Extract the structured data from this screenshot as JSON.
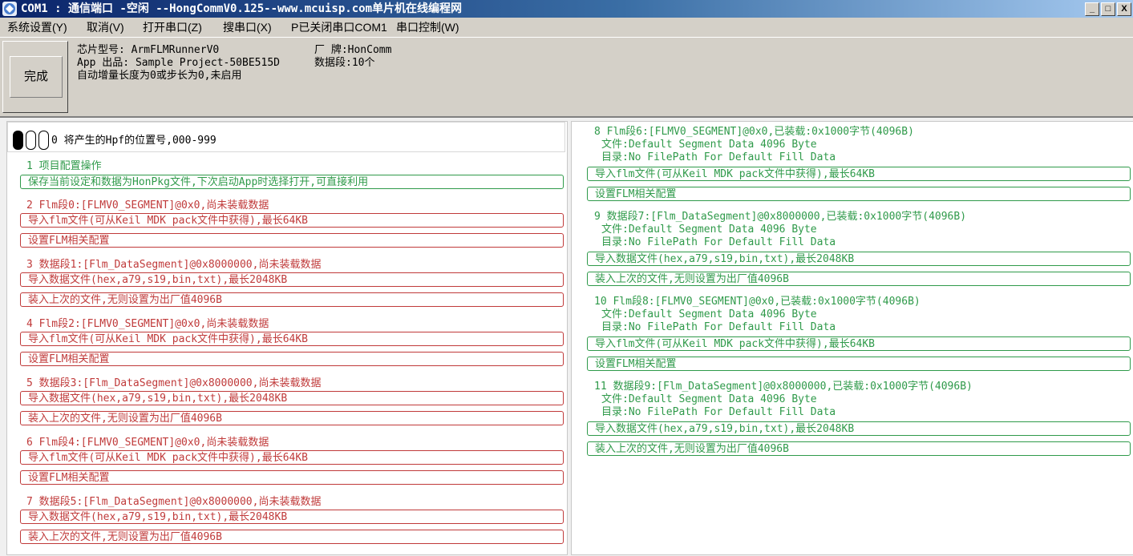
{
  "window": {
    "title": "COM1 : 通信端口 -空闲  --HongCommV0.125--www.mcuisp.com单片机在线编程网",
    "minimize": "_",
    "maximize": "□",
    "close": "X"
  },
  "menu": [
    "系统设置(Y)",
    "取消(V)",
    "打开串口(Z)",
    "搜串口(X)",
    "P已关闭串口COM1",
    "串口控制(W)"
  ],
  "done_button": "完成",
  "info": {
    "chip": "芯片型号: ArmFLMRunnerV0",
    "vendor": "厂  牌:HonComm",
    "app": "App 出品: Sample Project-50BE515D",
    "segments": "数据段:10个",
    "autoinc": "自动增量长度为0或步长为0,未启用"
  },
  "hpf": "0 将产生的Hpf的位置号,000-999",
  "left": {
    "project": {
      "title": "1 项目配置操作",
      "save": "保存当前设定和数据为HonPkg文件,下次启动App时选择打开,可直接利用"
    },
    "sec2": {
      "title": "2  Flm段0:[FLMV0_SEGMENT]@0x0,尚未装载数据",
      "b1": "导入flm文件(可从Keil MDK pack文件中获得),最长64KB",
      "b2": "设置FLM相关配置"
    },
    "sec3": {
      "title": "3 数据段1:[Flm_DataSegment]@0x8000000,尚未装载数据",
      "b1": "导入数据文件(hex,a79,s19,bin,txt),最长2048KB",
      "b2": "装入上次的文件,无则设置为出厂值4096B"
    },
    "sec4": {
      "title": "4  Flm段2:[FLMV0_SEGMENT]@0x0,尚未装载数据",
      "b1": "导入flm文件(可从Keil MDK pack文件中获得),最长64KB",
      "b2": "设置FLM相关配置"
    },
    "sec5": {
      "title": "5 数据段3:[Flm_DataSegment]@0x8000000,尚未装载数据",
      "b1": "导入数据文件(hex,a79,s19,bin,txt),最长2048KB",
      "b2": "装入上次的文件,无则设置为出厂值4096B"
    },
    "sec6": {
      "title": "6  Flm段4:[FLMV0_SEGMENT]@0x0,尚未装载数据",
      "b1": "导入flm文件(可从Keil MDK pack文件中获得),最长64KB",
      "b2": "设置FLM相关配置"
    },
    "sec7": {
      "title": "7 数据段5:[Flm_DataSegment]@0x8000000,尚未装载数据",
      "b1": "导入数据文件(hex,a79,s19,bin,txt),最长2048KB",
      "b2": "装入上次的文件,无则设置为出厂值4096B"
    }
  },
  "right": {
    "sec8": {
      "title": "8  Flm段6:[FLMV0_SEGMENT]@0x0,已装载:0x1000字节(4096B)",
      "file": "文件:Default Segment Data 4096 Byte",
      "dir": "目录:No FilePath For Default Fill Data",
      "b1": "导入flm文件(可从Keil MDK pack文件中获得),最长64KB",
      "b2": "设置FLM相关配置"
    },
    "sec9": {
      "title": "9 数据段7:[Flm_DataSegment]@0x8000000,已装载:0x1000字节(4096B)",
      "file": "文件:Default Segment Data 4096 Byte",
      "dir": "目录:No FilePath For Default Fill Data",
      "b1": "导入数据文件(hex,a79,s19,bin,txt),最长2048KB",
      "b2": "装入上次的文件,无则设置为出厂值4096B"
    },
    "sec10": {
      "title": "10  Flm段8:[FLMV0_SEGMENT]@0x0,已装载:0x1000字节(4096B)",
      "file": "文件:Default Segment Data 4096 Byte",
      "dir": "目录:No FilePath For Default Fill Data",
      "b1": "导入flm文件(可从Keil MDK pack文件中获得),最长64KB",
      "b2": "设置FLM相关配置"
    },
    "sec11": {
      "title": "11 数据段9:[Flm_DataSegment]@0x8000000,已装载:0x1000字节(4096B)",
      "file": "文件:Default Segment Data 4096 Byte",
      "dir": "目录:No FilePath For Default Fill Data",
      "b1": "导入数据文件(hex,a79,s19,bin,txt),最长2048KB",
      "b2": "装入上次的文件,无则设置为出厂值4096B"
    }
  },
  "colors": {
    "red": "#c03a3a",
    "green": "#2f9a4a",
    "titlebar": "#0a246a",
    "chrome": "#d4d0c8"
  },
  "icons": {
    "app": "app-logo-icon",
    "spin": "spin-control-icon"
  }
}
